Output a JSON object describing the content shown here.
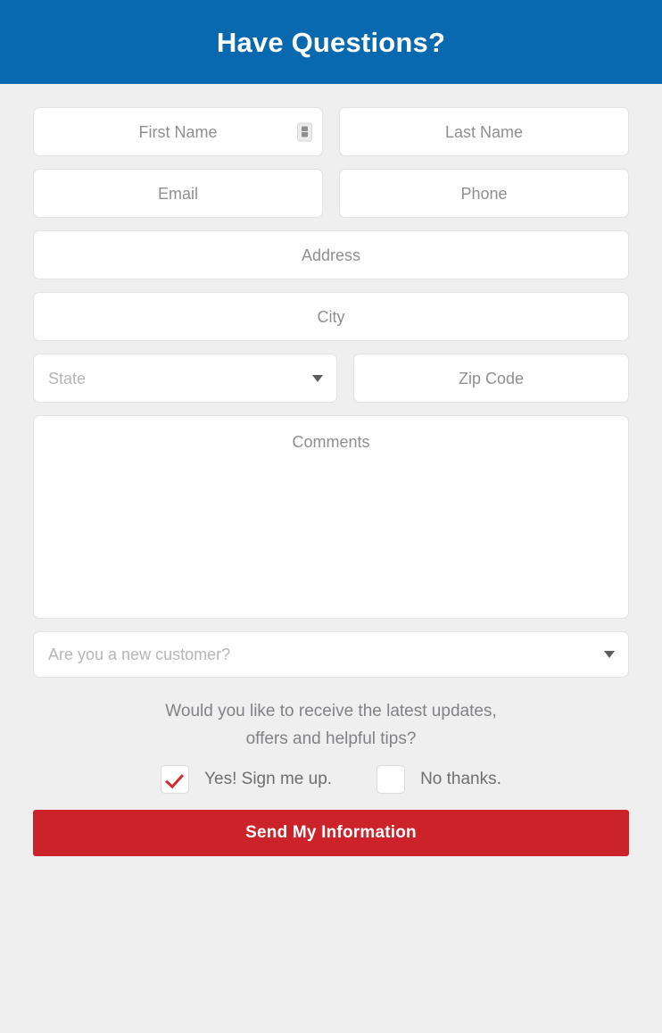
{
  "header": {
    "title": "Have Questions?",
    "background_color": "#0868b0",
    "text_color": "#ffffff"
  },
  "form": {
    "background_color": "#efefef",
    "fields": {
      "first_name": {
        "placeholder": "First Name",
        "value": "",
        "icon": "autofill-contact-card-icon"
      },
      "last_name": {
        "placeholder": "Last Name",
        "value": ""
      },
      "email": {
        "placeholder": "Email",
        "value": ""
      },
      "phone": {
        "placeholder": "Phone",
        "value": ""
      },
      "address": {
        "placeholder": "Address",
        "value": ""
      },
      "city": {
        "placeholder": "City",
        "value": ""
      },
      "state": {
        "placeholder": "State",
        "value": "State"
      },
      "zip_code": {
        "placeholder": "Zip Code",
        "value": ""
      },
      "comments": {
        "placeholder": "Comments",
        "value": ""
      },
      "new_customer": {
        "placeholder": "Are you a new customer?",
        "value": "Are you a new customer?"
      }
    },
    "optin": {
      "question_line1": "Would you like to receive the latest updates,",
      "question_line2": "offers and helpful tips?",
      "yes_label": "Yes! Sign me up.",
      "no_label": "No thanks.",
      "yes_checked": true,
      "no_checked": false,
      "check_color": "#d32b2f"
    },
    "submit": {
      "label": "Send My Information",
      "background_color": "#cc2229",
      "text_color": "#ffffff"
    }
  }
}
